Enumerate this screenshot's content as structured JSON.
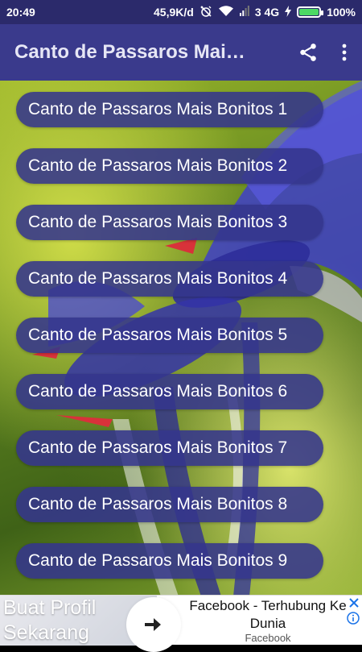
{
  "status_bar": {
    "time": "20:49",
    "speed": "45,9K/d",
    "network": "3 4G",
    "battery": "100%",
    "battery_level": 1.0
  },
  "app_bar": {
    "title": "Canto de Passaros Mais...",
    "share_icon": "share-icon",
    "menu_icon": "more-vert-icon"
  },
  "list": {
    "items": [
      "Canto de Passaros Mais Bonitos 1",
      "Canto de Passaros Mais Bonitos 2",
      "Canto de Passaros Mais Bonitos 3",
      "Canto de Passaros Mais Bonitos 4",
      "Canto de Passaros Mais Bonitos 5",
      "Canto de Passaros Mais Bonitos 6",
      "Canto de Passaros Mais Bonitos 7",
      "Canto de Passaros Mais Bonitos 8",
      "Canto de Passaros Mais Bonitos 9"
    ]
  },
  "ad": {
    "left_text": "Buat Profil Sekarang",
    "headline": "Facebook - Terhubung Ke Dunia",
    "source": "Facebook"
  },
  "colors": {
    "status_bar": "#2b2a6b",
    "app_bar": "#3a3a8c",
    "list_item": "#34368c",
    "battery_fill": "#4cd964",
    "ad_close": "#1a73e8"
  }
}
